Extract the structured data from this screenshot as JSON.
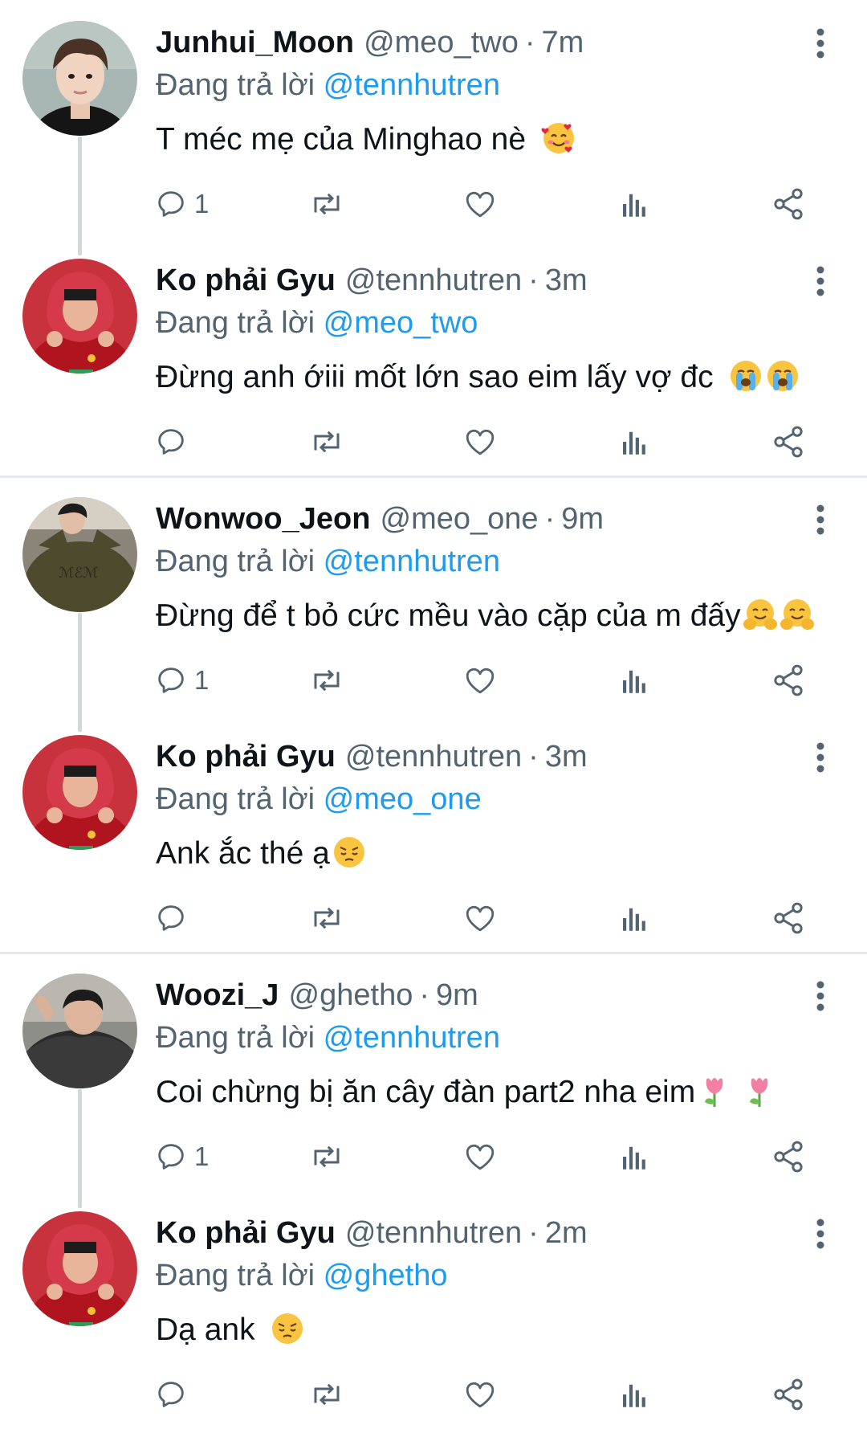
{
  "reply_prefix": "Đang trả lời",
  "colors": {
    "link": "#1d9bf0",
    "secondary": "#536471",
    "icon": "#536471",
    "divider": "#e6e9eb",
    "thread_line": "#cfd9de"
  },
  "threads": [
    {
      "tweets": [
        {
          "name": "Junhui_Moon",
          "handle": "@meo_two",
          "dot": "·",
          "time": "7m",
          "reply_to": "@tennhutren",
          "text": "T méc mẹ của Minghao nè",
          "emojis": [
            "smiling-face-with-hearts-emoji"
          ],
          "reply_count": "1"
        },
        {
          "name": "Ko phải Gyu",
          "handle": "@tennhutren",
          "dot": "·",
          "time": "3m",
          "reply_to": "@meo_two",
          "text": "Đừng anh ớiii mốt lớn sao eim lấy vợ đc",
          "emojis": [
            "loudly-crying-face-emoji",
            "loudly-crying-face-emoji"
          ],
          "reply_count": ""
        }
      ]
    },
    {
      "tweets": [
        {
          "name": "Wonwoo_Jeon",
          "handle": "@meo_one",
          "dot": "·",
          "time": "9m",
          "reply_to": "@tennhutren",
          "text": "Đừng để t bỏ cức mều vào cặp của m đấy",
          "emojis": [
            "hugging-face-emoji",
            "hugging-face-emoji"
          ],
          "reply_count": "1"
        },
        {
          "name": "Ko phải Gyu",
          "handle": "@tennhutren",
          "dot": "·",
          "time": "3m",
          "reply_to": "@meo_one",
          "text": "Ank ắc thé ạ",
          "emojis": [
            "pensive-face-emoji"
          ],
          "reply_count": ""
        }
      ]
    },
    {
      "tweets": [
        {
          "name": "Woozi_J",
          "handle": "@ghetho",
          "dot": "·",
          "time": "9m",
          "reply_to": "@tennhutren",
          "text": "Coi chừng bị ăn cây đàn part2 nha eim",
          "emojis": [
            "tulip-emoji",
            "tulip-emoji"
          ],
          "reply_count": "1"
        },
        {
          "name": "Ko phải Gyu",
          "handle": "@tennhutren",
          "dot": "·",
          "time": "2m",
          "reply_to": "@ghetho",
          "text": "Dạ ank",
          "emojis": [
            "pensive-face-emoji"
          ],
          "reply_count": ""
        }
      ]
    }
  ],
  "icons": {
    "reply": "reply-icon",
    "retweet": "retweet-icon",
    "like": "like-icon",
    "views": "views-icon",
    "share": "share-icon",
    "more": "more-options-icon"
  }
}
